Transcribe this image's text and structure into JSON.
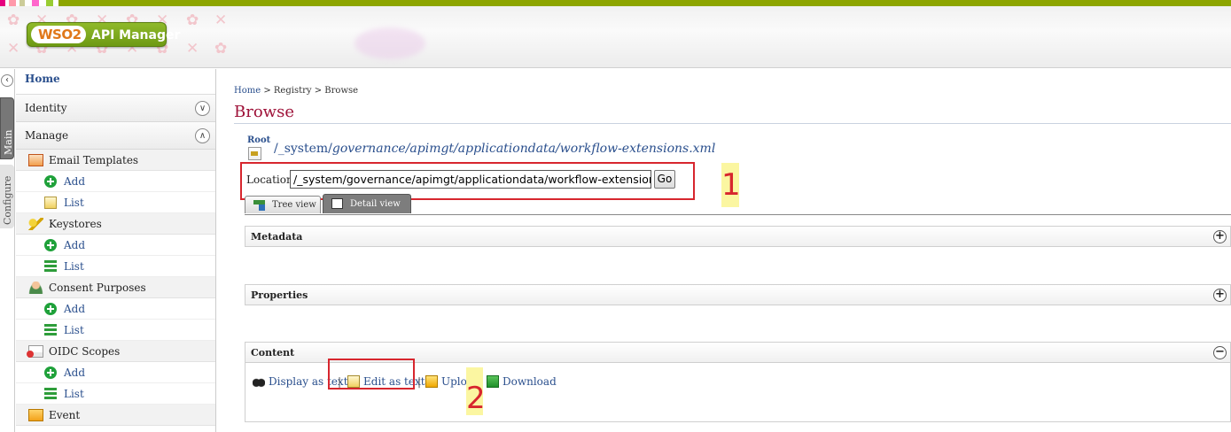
{
  "header": {
    "logo_brand": "WSO2",
    "product_name": "API Manager"
  },
  "vertical_tabs": {
    "main": "Main",
    "configure": "Configure"
  },
  "sidebar": {
    "home": "Home",
    "sections": [
      {
        "label": "Identity",
        "state": "collapsed"
      },
      {
        "label": "Manage",
        "state": "expanded"
      }
    ],
    "categories": [
      {
        "label": "Email Templates",
        "icon": "email-icon",
        "add": "Add",
        "list": "List"
      },
      {
        "label": "Keystores",
        "icon": "key-icon",
        "add": "Add",
        "list": "List"
      },
      {
        "label": "Consent Purposes",
        "icon": "user-icon",
        "add": "Add",
        "list": "List"
      },
      {
        "label": "OIDC Scopes",
        "icon": "scope-icon",
        "add": "Add",
        "list": "List"
      },
      {
        "label": "Event",
        "icon": "event-icon"
      }
    ]
  },
  "breadcrumb": {
    "home": "Home",
    "sep": " > ",
    "registry": "Registry",
    "current": "Browse"
  },
  "page_title": "Browse",
  "browse": {
    "root_link": "Root",
    "path_root": "/_system/",
    "path_rest": "governance/apimgt/applicationdata/workflow-extensions.xml",
    "location_label": "Location:",
    "location_value": "/_system/governance/apimgt/applicationdata/workflow-extensions.xml",
    "go_button": "Go",
    "annotation_1": "1",
    "annotation_2": "2"
  },
  "tabs": {
    "tree": "Tree view",
    "detail": "Detail view"
  },
  "sections": {
    "metadata": "Metadata",
    "properties": "Properties",
    "content": "Content",
    "expand_symbol": "+",
    "collapse_symbol": "−"
  },
  "content_actions": {
    "display_as_text": "Display as text",
    "edit_as_text": "Edit as text",
    "upload": "Upload",
    "download": "Download",
    "separator": "|"
  },
  "colors": {
    "brand_green": "#8da500",
    "title_red": "#9e1138",
    "link_blue": "#2a4f8d",
    "annotation_red": "#d7262e",
    "highlight_yellow": "#fbf6a1"
  }
}
